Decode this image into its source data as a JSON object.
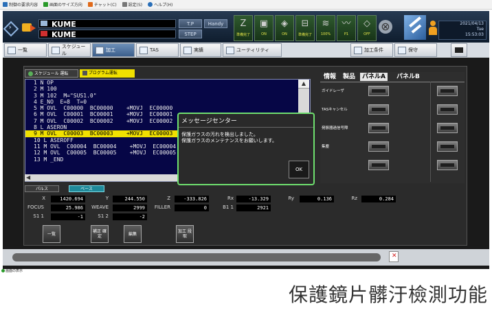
{
  "menubar": {
    "items": [
      {
        "label": "制御の要求内容",
        "color": "#2a6fb8"
      },
      {
        "label": "画面のサイズ方向",
        "color": "#2a9a2a"
      },
      {
        "label": "チャット(C)",
        "color": "#e06a1a"
      },
      {
        "label": "設定(S)",
        "color": "#777777"
      },
      {
        "label": "ヘルプ(H)",
        "color": "#2a6fb8"
      }
    ]
  },
  "header": {
    "machine1": "KUME",
    "machine2": "KUME",
    "btn_tp": "T.P",
    "btn_handy": "Handy",
    "btn_step": "STEP",
    "status": [
      {
        "label": "準備完了",
        "icon": "Z"
      },
      {
        "label": "ON",
        "icon": "▣"
      },
      {
        "label": "ON",
        "icon": "◈"
      },
      {
        "label": "準備完了",
        "icon": "⊟"
      },
      {
        "label": "100%",
        "icon": "≋"
      },
      {
        "label": "P1",
        "icon": "〰"
      },
      {
        "label": "OFF",
        "icon": "◇"
      }
    ],
    "close_icon": "⊗",
    "clock": {
      "date": "2021/04/13",
      "day": "Tue",
      "time": "15:53:03"
    }
  },
  "tabs": [
    {
      "label": "一覧"
    },
    {
      "label": "スケジュール"
    },
    {
      "label": "加工"
    },
    {
      "label": "TAS"
    },
    {
      "label": "実績"
    },
    {
      "label": "ユーティリティ"
    },
    {
      "label": "加工条件"
    },
    {
      "label": "保守"
    }
  ],
  "subtabs": {
    "schedule": "スケジュール 運転",
    "program": "プログラム運転"
  },
  "program": {
    "lines": [
      "1 N OP",
      "2 M 100",
      "3 M 102  M=\"SUS1.0\"",
      "4 E_NO  E=8  T=0",
      "5 M OVL  C00000  BC00000    +MOVJ  EC00000",
      "6 M OVL  C00001  BC00001    +MOVJ  EC00001",
      "7 M OVL  C00002  BC00002    +MOVJ  EC00002",
      "8 L ASERON",
      "9 M OVL  C00003  BC00003    +MOVJ  EC00003",
      "10 L ASEROFF",
      "11 M OVL  C00004  BC00004    +MOVJ  EC00004",
      "12 M OVL  C00005  BC00005    +MOVJ  EC00005",
      "13 M _END"
    ],
    "highlight_index": 8
  },
  "dialog": {
    "title": "メッセージセンター",
    "message1": "保護ガラスの汚れを検出しました。",
    "message2": "保護ガラスのメンテナンスをお願いします。",
    "ok": "OK"
  },
  "right_panel": {
    "tabs": [
      "情報",
      "製品",
      "パネルA",
      "パネルB"
    ],
    "active": 2,
    "labels": [
      "ガイドレーザ",
      "TASキャンセル",
      "発振器過信号障",
      "集塵"
    ]
  },
  "mode": {
    "pulse": "パルス",
    "base": "ベース"
  },
  "coords": {
    "x_label": "X",
    "x": "1420.694",
    "y_label": "Y",
    "y": "244.550",
    "z_label": "Z",
    "z": "-333.826",
    "rx_label": "Rx",
    "rx": "-13.329",
    "ry_label": "Ry",
    "ry": "0.136",
    "rz_label": "Rz",
    "rz": "0.284",
    "focus_label": "FOCUS",
    "focus": "25.986",
    "weave_label": "WEAVE",
    "weave": "2999",
    "filler_label": "FILLER",
    "filler": "0",
    "b11_label": "B1 1",
    "b11": "2921",
    "s11_label": "S1 1",
    "s11": "-1",
    "s12_label": "S1 2",
    "s12": "-2"
  },
  "func_buttons": [
    "一覧",
    "補正 確定",
    "編集",
    "加工 段取"
  ],
  "statusbar": "画面の表示",
  "caption": "保護鏡片髒汙檢測功能"
}
